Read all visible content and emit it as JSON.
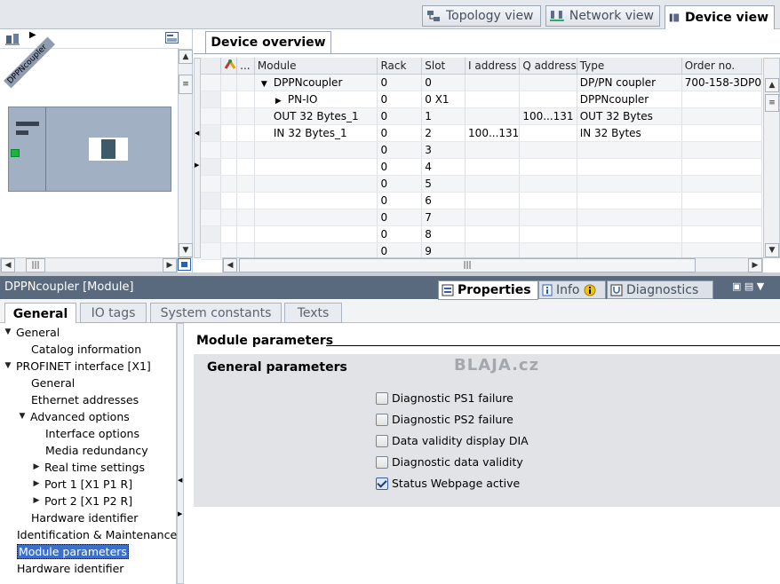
{
  "view_tabs": [
    {
      "label": "Topology view",
      "icon": "topology-icon"
    },
    {
      "label": "Network view",
      "icon": "network-icon"
    },
    {
      "label": "Device view",
      "icon": "device-icon",
      "active": true
    }
  ],
  "graphic": {
    "device_label": "DPPNcoupler"
  },
  "device_overview": {
    "tab_label": "Device overview",
    "columns": [
      "",
      "",
      "...",
      "Module",
      "Rack",
      "Slot",
      "I address",
      "Q address",
      "Type",
      "Order no."
    ],
    "rows": [
      {
        "indent": 1,
        "arrow": "down",
        "module": "DPPNcoupler",
        "rack": "0",
        "slot": "0",
        "iaddr": "",
        "qaddr": "",
        "type": "DP/PN coupler",
        "order": "700-158-3DP0"
      },
      {
        "indent": 2,
        "arrow": "right",
        "module": "PN-IO",
        "rack": "0",
        "slot": "0 X1",
        "iaddr": "",
        "qaddr": "",
        "type": "DPPNcoupler",
        "order": ""
      },
      {
        "indent": 1,
        "arrow": "",
        "module": "OUT  32 Bytes_1",
        "rack": "0",
        "slot": "1",
        "iaddr": "",
        "qaddr": "100...131",
        "type": "OUT  32 Bytes",
        "order": ""
      },
      {
        "indent": 1,
        "arrow": "",
        "module": "IN  32 Bytes_1",
        "rack": "0",
        "slot": "2",
        "iaddr": "100...131",
        "qaddr": "",
        "type": "IN  32 Bytes",
        "order": ""
      },
      {
        "indent": 0,
        "arrow": "",
        "module": "",
        "rack": "0",
        "slot": "3",
        "iaddr": "",
        "qaddr": "",
        "type": "",
        "order": ""
      },
      {
        "indent": 0,
        "arrow": "",
        "module": "",
        "rack": "0",
        "slot": "4",
        "iaddr": "",
        "qaddr": "",
        "type": "",
        "order": ""
      },
      {
        "indent": 0,
        "arrow": "",
        "module": "",
        "rack": "0",
        "slot": "5",
        "iaddr": "",
        "qaddr": "",
        "type": "",
        "order": ""
      },
      {
        "indent": 0,
        "arrow": "",
        "module": "",
        "rack": "0",
        "slot": "6",
        "iaddr": "",
        "qaddr": "",
        "type": "",
        "order": ""
      },
      {
        "indent": 0,
        "arrow": "",
        "module": "",
        "rack": "0",
        "slot": "7",
        "iaddr": "",
        "qaddr": "",
        "type": "",
        "order": ""
      },
      {
        "indent": 0,
        "arrow": "",
        "module": "",
        "rack": "0",
        "slot": "8",
        "iaddr": "",
        "qaddr": "",
        "type": "",
        "order": ""
      },
      {
        "indent": 0,
        "arrow": "",
        "module": "",
        "rack": "0",
        "slot": "9",
        "iaddr": "",
        "qaddr": "",
        "type": "",
        "order": ""
      }
    ]
  },
  "inspector": {
    "title": "DPPNcoupler [Module]",
    "tabs": [
      {
        "label": "Properties",
        "icon": "properties-icon",
        "active": true
      },
      {
        "label": "Info",
        "icon": "info-icon"
      },
      {
        "label": "Diagnostics",
        "icon": "diagnostics-icon"
      }
    ],
    "subtabs": [
      {
        "label": "General",
        "active": true
      },
      {
        "label": "IO tags"
      },
      {
        "label": "System constants"
      },
      {
        "label": "Texts"
      }
    ]
  },
  "nav_tree": [
    {
      "label": "General",
      "level": 0,
      "arrow": "down"
    },
    {
      "label": "Catalog information",
      "level": 2,
      "arrow": ""
    },
    {
      "label": "PROFINET interface [X1]",
      "level": 0,
      "arrow": "down"
    },
    {
      "label": "General",
      "level": 2,
      "arrow": ""
    },
    {
      "label": "Ethernet addresses",
      "level": 2,
      "arrow": ""
    },
    {
      "label": "Advanced options",
      "level": 1,
      "arrow": "down"
    },
    {
      "label": "Interface options",
      "level": 3,
      "arrow": ""
    },
    {
      "label": "Media redundancy",
      "level": 3,
      "arrow": ""
    },
    {
      "label": "Real time settings",
      "level": 2,
      "arrow": "right"
    },
    {
      "label": "Port 1 [X1 P1 R]",
      "level": 2,
      "arrow": "right"
    },
    {
      "label": "Port 2 [X1 P2 R]",
      "level": 2,
      "arrow": "right"
    },
    {
      "label": "Hardware identifier",
      "level": 2,
      "arrow": ""
    },
    {
      "label": "Identification & Maintenance",
      "level": 0,
      "arrow": ""
    },
    {
      "label": "Module parameters",
      "level": 0,
      "arrow": "",
      "selected": true
    },
    {
      "label": "Hardware identifier",
      "level": 0,
      "arrow": ""
    }
  ],
  "module_parameters": {
    "heading": "Module parameters",
    "section": "General parameters",
    "watermark": "BLAJA.cz",
    "options": [
      {
        "label": "Diagnostic PS1 failure",
        "checked": false
      },
      {
        "label": "Diagnostic PS2 failure",
        "checked": false
      },
      {
        "label": "Data validity display DIA",
        "checked": false
      },
      {
        "label": "Diagnostic data validity",
        "checked": false
      },
      {
        "label": "Status Webpage active",
        "checked": true
      }
    ]
  }
}
